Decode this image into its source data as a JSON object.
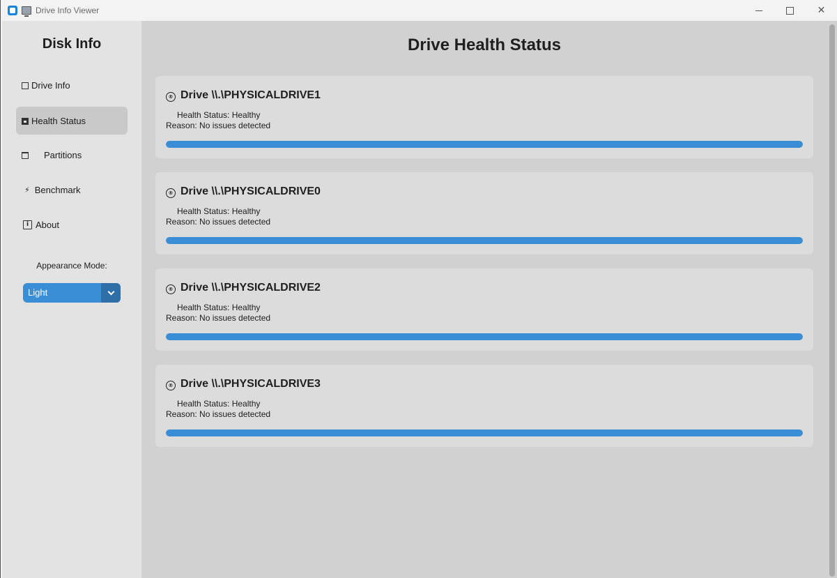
{
  "window": {
    "title": "Drive Info Viewer",
    "controls": {
      "minimize": "",
      "maximize": "",
      "close": "✕"
    }
  },
  "sidebar": {
    "title": "Disk Info",
    "items": [
      {
        "label": "Drive Info",
        "icon": "drive-icon",
        "active": false
      },
      {
        "label": "Health Status",
        "icon": "chart-icon",
        "active": true
      },
      {
        "label": "Partitions",
        "icon": "calendar-icon",
        "active": false
      },
      {
        "label": "Benchmark",
        "icon": "lightning-icon",
        "glyph": "⚡",
        "active": false
      },
      {
        "label": "About",
        "icon": "info-icon",
        "glyph": "i",
        "active": false
      }
    ],
    "appearance_label": "Appearance Mode:",
    "appearance_value": "Light"
  },
  "main": {
    "title": "Drive Health Status",
    "drives": [
      {
        "name": "Drive \\\\.\\PHYSICALDRIVE1",
        "status": "Health Status: Healthy",
        "reason": "Reason: No issues detected",
        "progress": 1.0
      },
      {
        "name": "Drive \\\\.\\PHYSICALDRIVE0",
        "status": "Health Status: Healthy",
        "reason": "Reason: No issues detected",
        "progress": 1.0
      },
      {
        "name": "Drive \\\\.\\PHYSICALDRIVE2",
        "status": "Health Status: Healthy",
        "reason": "Reason: No issues detected",
        "progress": 1.0
      },
      {
        "name": "Drive \\\\.\\PHYSICALDRIVE3",
        "status": "Health Status: Healthy",
        "reason": "Reason: No issues detected",
        "progress": 1.0
      }
    ]
  },
  "colors": {
    "accent": "#3a8ed6",
    "accent_dark": "#2e6fa8",
    "sidebar_bg": "#e3e3e3",
    "main_bg": "#d1d1d1",
    "card_bg": "#dcdcdc"
  }
}
